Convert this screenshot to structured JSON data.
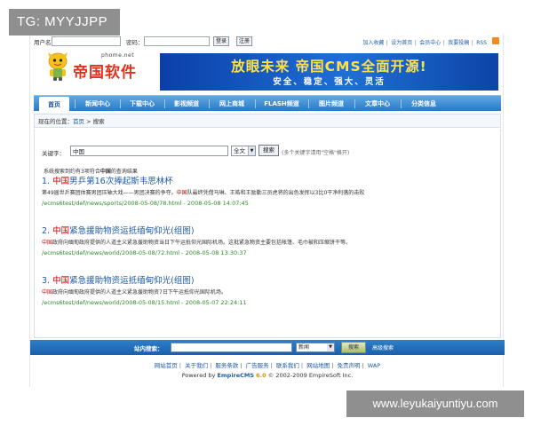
{
  "watermarks": {
    "top": "TG: MYYJJPP",
    "bottom": "www.leyukaiyuntiyu.com"
  },
  "topbar": {
    "username_label": "用户名：",
    "password_label": "密码：",
    "login_button": "登录",
    "register_button": "注册",
    "links": [
      "加入收藏",
      "设为首页",
      "会员中心",
      "我要投稿",
      "RSS"
    ]
  },
  "logo": {
    "domain": "phome.net",
    "name": "帝国软件"
  },
  "banner": {
    "title": "放眼未来 帝国CMS全面开源!",
    "subtitle": "安全、稳定、强大、灵活"
  },
  "nav": [
    "首页",
    "新闻中心",
    "下载中心",
    "影视频道",
    "网上商城",
    "FLASH频道",
    "图片频道",
    "文章中心",
    "分类信息"
  ],
  "breadcrumb": {
    "prefix": "现在的位置：",
    "home": "首页",
    "sep": " > ",
    "current": "搜索"
  },
  "search": {
    "keyword_label": "关键字：",
    "keyword_value": "中国",
    "scope": "全文",
    "button": "搜索",
    "hint": "(多个关键字请用\"空格\"格开)"
  },
  "summary": {
    "prefix": "系统搜索到约有",
    "count": "3",
    "middle": "项符合",
    "keyword": "中国",
    "suffix": "的查询结果"
  },
  "results": [
    {
      "num": "1.",
      "hl": "中国",
      "title_rest": "男乒第16次捧起斯韦思林杯",
      "desc_pre": "第49届世乒赛团体赛男团压轴大戏——男团决赛的争夺。",
      "desc_hl": "中国",
      "desc_rest": "队最终凭借马琳、王皓和王励勤三员虎将的出色发挥以3比0干净利落的击败",
      "url": "/ecms6test/def/news/sports/2008-05-08/78.html",
      "date": "2008-05-08 14:07:45"
    },
    {
      "num": "2.",
      "hl": "中国",
      "title_rest": "紧急援助物资运抵缅甸仰光(组图)",
      "desc_pre": "",
      "desc_hl": "中国",
      "desc_rest": "政府向缅甸政府提供的人道主义紧急援助物资当日下午运抵仰光国际机场。这批紧急物资主要包括帐篷、毛巾被和压缩饼干等。",
      "url": "/ecms6test/def/news/world/2008-05-08/72.html",
      "date": "2008-05-08 13:30:37"
    },
    {
      "num": "3.",
      "hl": "中国",
      "title_rest": "紧急援助物资运抵缅甸仰光(组图)",
      "desc_pre": "",
      "desc_hl": "中国",
      "desc_rest": "政府向缅甸政府提供的人道主义紧急援助物资7日下午运抵仰光国际机场。",
      "url": "/ecms6test/def/news/world/2008-05-08/15.html",
      "date": "2008-05-07 22:24:11"
    }
  ],
  "footer_search": {
    "label": "站内搜索：",
    "scope": "新闻",
    "button": "搜索",
    "advanced": "高级搜索"
  },
  "footer_links": [
    "网站首页",
    "关于我们",
    "服务条款",
    "广告服务",
    "联系我们",
    "网站地图",
    "免责声明",
    "WAP"
  ],
  "copyright": {
    "prefix": "Powered by ",
    "brand": "EmpireCMS",
    "version": "6.0",
    "suffix": " © 2002-2009 EmpireSoft Inc."
  }
}
